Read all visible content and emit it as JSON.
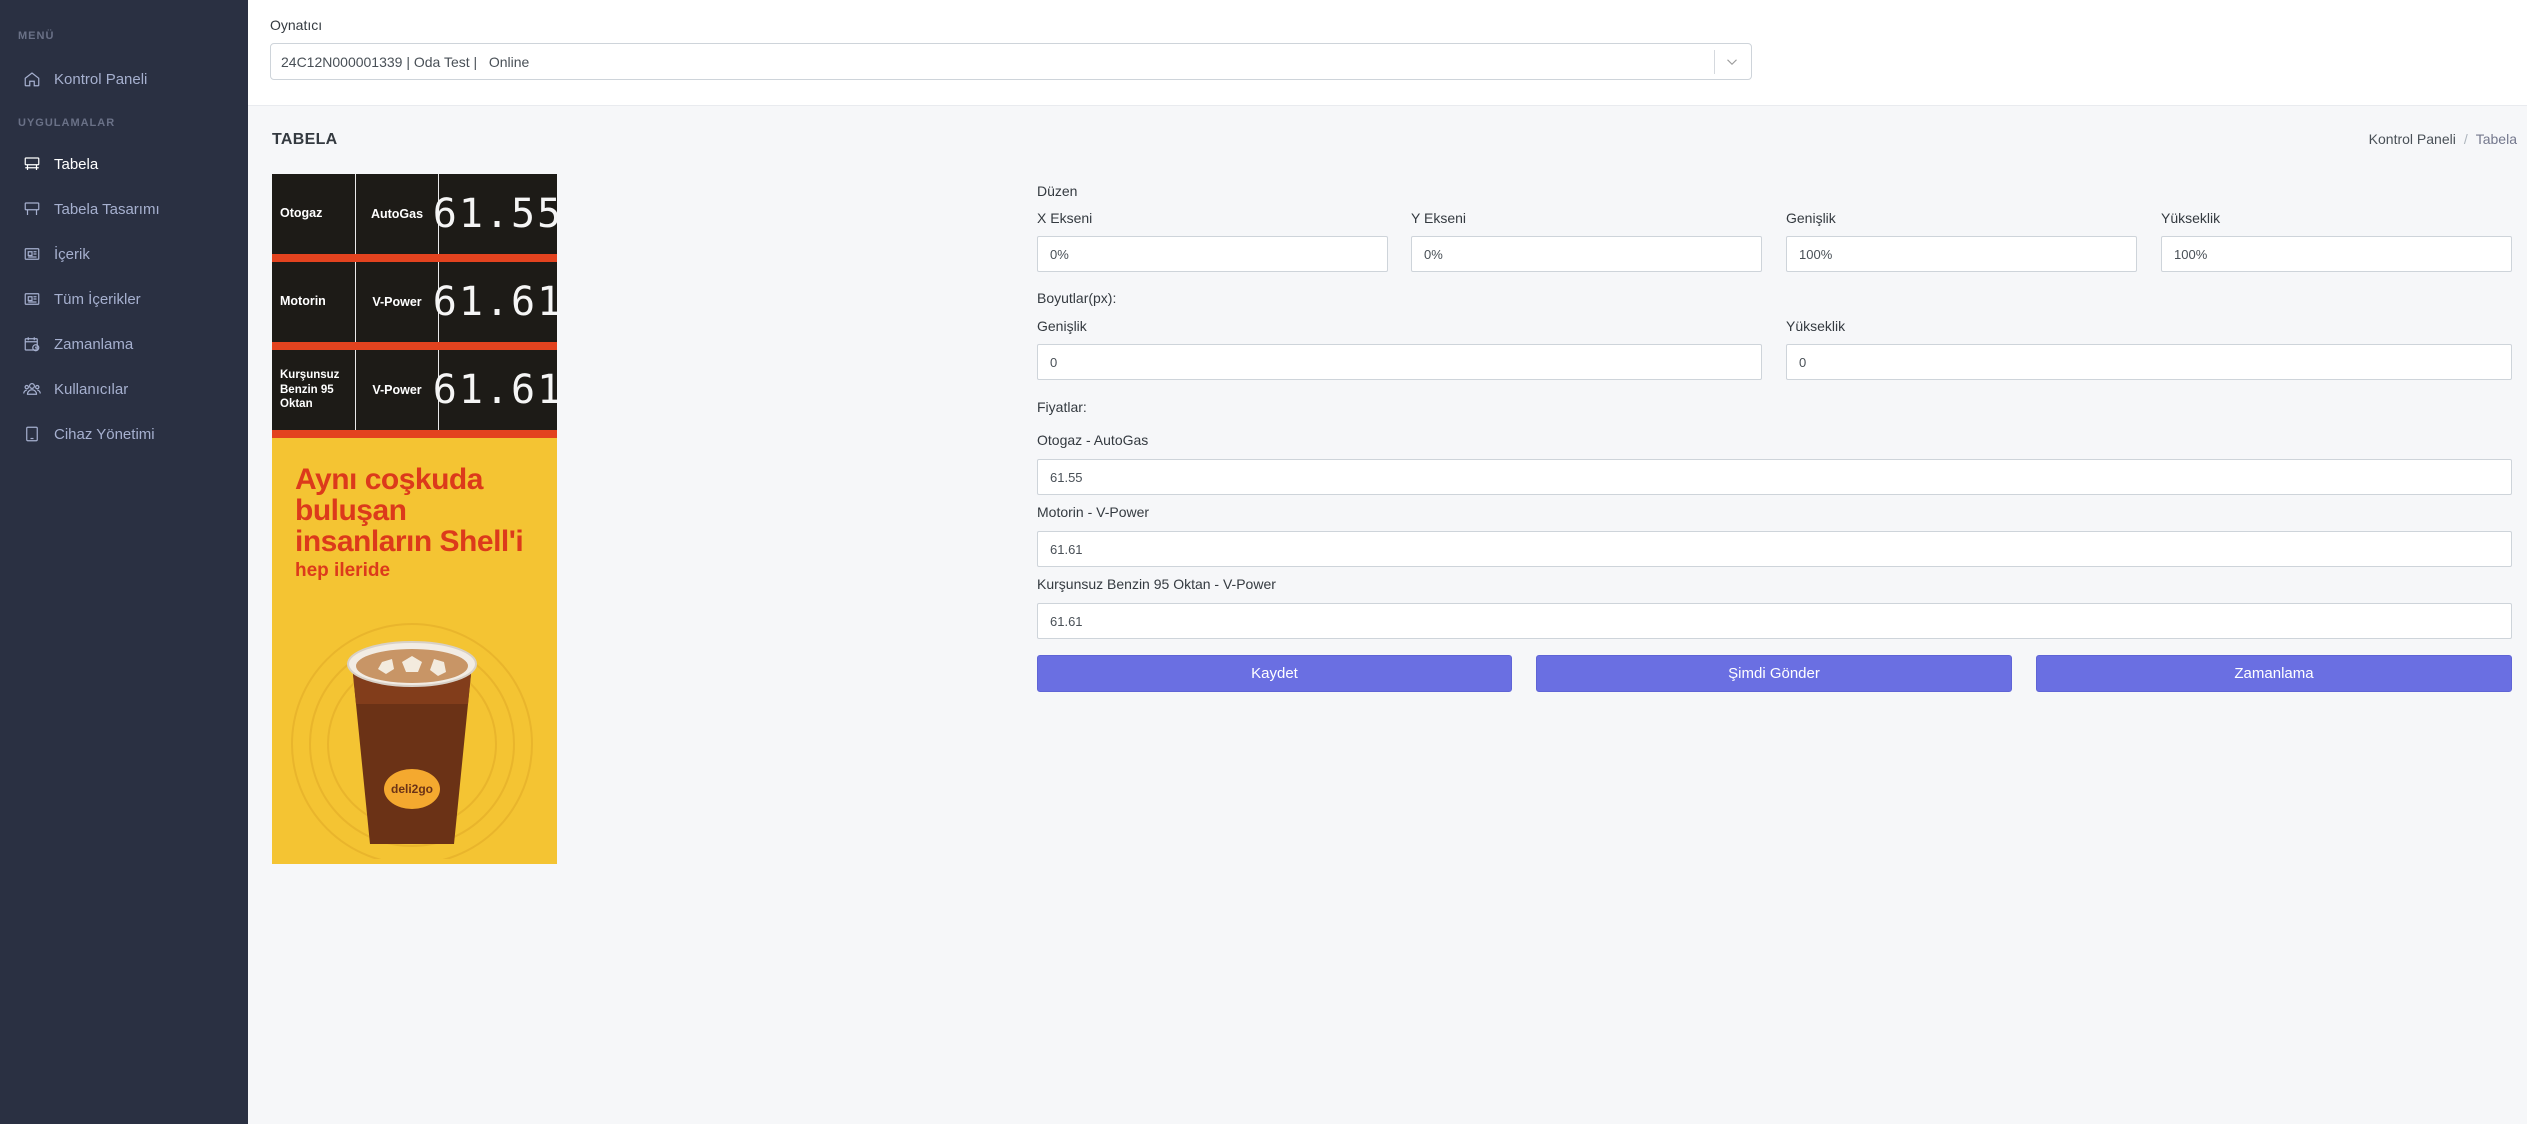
{
  "sidebar": {
    "menu_title": "MENÜ",
    "apps_title": "UYGULAMALAR",
    "dashboard": "Kontrol Paneli",
    "items": [
      {
        "label": "Tabela",
        "icon": "signboard-icon"
      },
      {
        "label": "Tabela Tasarımı",
        "icon": "signboard-design-icon"
      },
      {
        "label": "İçerik",
        "icon": "content-icon"
      },
      {
        "label": "Tüm İçerikler",
        "icon": "all-content-icon"
      },
      {
        "label": "Zamanlama",
        "icon": "calendar-clock-icon"
      },
      {
        "label": "Kullanıcılar",
        "icon": "users-icon"
      },
      {
        "label": "Cihaz Yönetimi",
        "icon": "tablet-icon"
      }
    ],
    "active_index": 0
  },
  "topbar": {
    "player_label": "Oynatıcı",
    "player_value": "24C12N000001339 | Oda Test |   Online"
  },
  "page": {
    "title": "TABELA",
    "breadcrumb": {
      "root": "Kontrol Paneli",
      "current": "Tabela"
    }
  },
  "board": {
    "rows": [
      {
        "fuel": "Otogaz",
        "brand": "AutoGas",
        "price": "61.55"
      },
      {
        "fuel": "Motorin",
        "brand": "V-Power",
        "price": "61.61"
      },
      {
        "fuel": "Kurşunsuz Benzin 95 Oktan",
        "brand": "V-Power",
        "price": "61.61"
      }
    ],
    "ad_headline": "Aynı coşkuda buluşan insanların Shell'i",
    "ad_sub": "hep ileride",
    "cup_logo": "deli2go"
  },
  "form": {
    "layout_label": "Düzen",
    "x_label": "X Ekseni",
    "x_value": "0%",
    "y_label": "Y Ekseni",
    "y_value": "0%",
    "width_label": "Genişlik",
    "width_value": "100%",
    "height_label": "Yükseklik",
    "height_value": "100%",
    "dims_label": "Boyutlar(px):",
    "px_width_label": "Genişlik",
    "px_width_value": "0",
    "px_height_label": "Yükseklik",
    "px_height_value": "0",
    "prices_label": "Fiyatlar:",
    "price1_label": "Otogaz - AutoGas",
    "price1_value": "61.55",
    "price2_label": "Motorin - V-Power",
    "price2_value": "61.61",
    "price3_label": "Kurşunsuz Benzin 95 Oktan - V-Power",
    "price3_value": "61.61",
    "save_button": "Kaydet",
    "send_now_button": "Şimdi Gönder",
    "schedule_button": "Zamanlama"
  },
  "colors": {
    "sidebar_bg": "#2a3042",
    "accent": "#6a6fe2",
    "board_yellow": "#f4c433",
    "board_red": "#e3431f"
  }
}
